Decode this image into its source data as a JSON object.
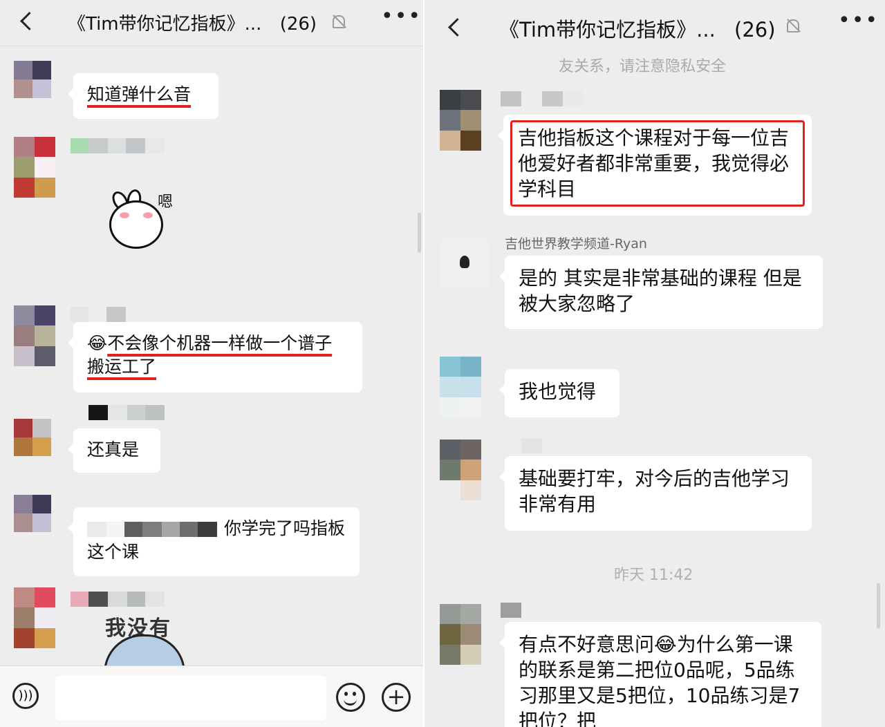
{
  "left": {
    "header": {
      "title": "《Tim带你记忆指板》...",
      "count": "(26)"
    },
    "messages": [
      {
        "text": "知道弹什么音"
      },
      {
        "sticker_caption": "嗯"
      },
      {
        "emoji": "😂",
        "text": "不会像个机器一样做一个谱子搬运工了"
      },
      {
        "text": "还真是"
      },
      {
        "text": "你学完了吗指板这个课"
      },
      {
        "sticker_caption": "我没有"
      }
    ]
  },
  "right": {
    "header": {
      "title": "《Tim带你记忆指板》...",
      "count": "(26)"
    },
    "system_note": "友关系，请注意隐私安全",
    "messages": [
      {
        "text": "吉他指板这个课程对于每一位吉他爱好者都非常重要，我觉得必学科目"
      },
      {
        "sender": "吉他世界教学频道-Ryan",
        "text": "是的 其实是非常基础的课程 但是被大家忽略了"
      },
      {
        "text": "我也觉得"
      },
      {
        "text": "基础要打牢，对今后的吉他学习非常有用"
      },
      {
        "text": "有点不好意思问😂为什么第一课的联系是第二把位0品呢，5品练习那里又是5把位，10品练习是7把位？把"
      }
    ],
    "timestamp": "昨天 11:42"
  },
  "colors": {
    "accent_red": "#e0221c",
    "background": "#ededed",
    "bubble": "#ffffff"
  }
}
